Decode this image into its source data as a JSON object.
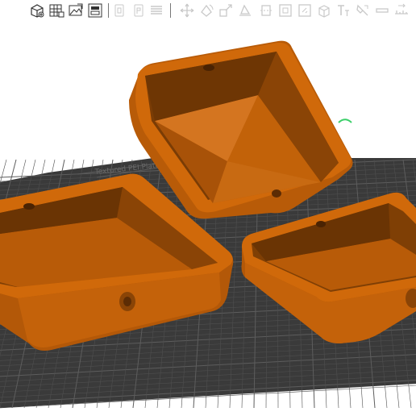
{
  "app": {
    "name": "3D slicer workspace"
  },
  "toolbar": {
    "groups": [
      [
        "add-object-icon",
        "arrange-grid-icon",
        "import-image-icon",
        "layout-icon"
      ],
      [
        "copy-icon",
        "paste-icon",
        "menu-icon"
      ],
      [
        "move-icon",
        "rotate-icon",
        "scale-icon",
        "place-on-face-icon",
        "cut-icon",
        "split-icon",
        "support-paint-icon",
        "seam-paint-icon",
        "box-icon",
        "text-tool-icon",
        "paint-icon",
        "minus-icon",
        "measure-icon"
      ]
    ],
    "active_icon_color": "#c9c9c9"
  },
  "viewport": {
    "background": "#ffffff",
    "plate_color": "#3a3a3a",
    "plate_grid_color": "#4f4f4f",
    "plate_major_grid_color": "#5d5d5d",
    "plate_label": "Textured PEI Plate",
    "object_color": "#d0690a",
    "object_shadow": "#8a4106",
    "object_highlight": "#e47c22",
    "axis_marker_color": "#3ccf6a",
    "objects": [
      {
        "name": "tilted-box-with-pyramid-lid",
        "has_mount_hole": true
      },
      {
        "name": "large-open-box",
        "has_mount_hole": true
      },
      {
        "name": "small-open-box",
        "has_mount_hole": true
      }
    ]
  }
}
